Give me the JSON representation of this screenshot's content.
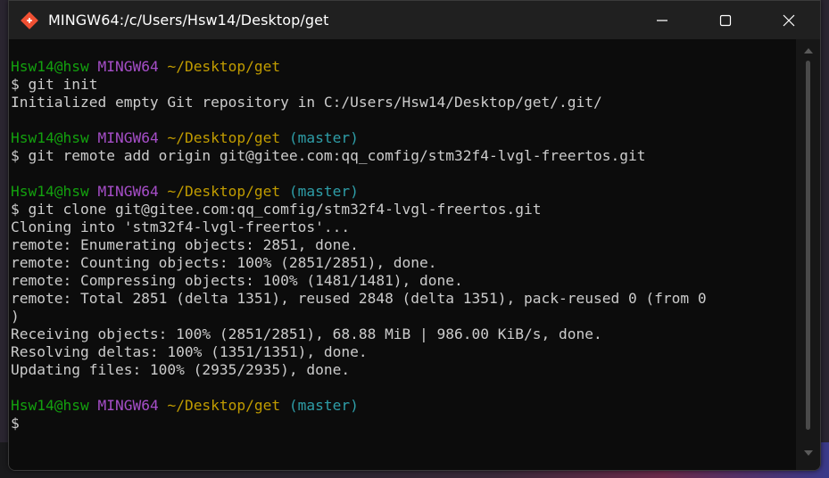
{
  "window": {
    "title": "MINGW64:/c/Users/Hsw14/Desktop/get",
    "icon": "git-bash-icon",
    "controls": {
      "minimize": "minimize-icon",
      "maximize": "maximize-icon",
      "close": "close-icon"
    }
  },
  "colors": {
    "user_host": "#13a10e",
    "shell": "#a64ec8",
    "path": "#c19c00",
    "branch": "#2e9ea8",
    "text": "#cccccc",
    "background": "#0c0c0c"
  },
  "terminal": {
    "block1": {
      "prompt_user": "Hsw14@hsw",
      "prompt_shell": "MINGW64",
      "prompt_path": "~/Desktop/get",
      "command": "$ git init",
      "output": [
        "Initialized empty Git repository in C:/Users/Hsw14/Desktop/get/.git/"
      ]
    },
    "block2": {
      "prompt_user": "Hsw14@hsw",
      "prompt_shell": "MINGW64",
      "prompt_path": "~/Desktop/get",
      "prompt_branch": "(master)",
      "command": "$ git remote add origin git@gitee.com:qq_comfig/stm32f4-lvgl-freertos.git"
    },
    "block3": {
      "prompt_user": "Hsw14@hsw",
      "prompt_shell": "MINGW64",
      "prompt_path": "~/Desktop/get",
      "prompt_branch": "(master)",
      "command": "$ git clone git@gitee.com:qq_comfig/stm32f4-lvgl-freertos.git",
      "output": [
        "Cloning into 'stm32f4-lvgl-freertos'...",
        "remote: Enumerating objects: 2851, done.",
        "remote: Counting objects: 100% (2851/2851), done.",
        "remote: Compressing objects: 100% (1481/1481), done.",
        "remote: Total 2851 (delta 1351), reused 2848 (delta 1351), pack-reused 0 (from 0",
        ")",
        "Receiving objects: 100% (2851/2851), 68.88 MiB | 986.00 KiB/s, done.",
        "Resolving deltas: 100% (1351/1351), done.",
        "Updating files: 100% (2935/2935), done."
      ]
    },
    "block4": {
      "prompt_user": "Hsw14@hsw",
      "prompt_shell": "MINGW64",
      "prompt_path": "~/Desktop/get",
      "prompt_branch": "(master)",
      "command": "$"
    }
  }
}
